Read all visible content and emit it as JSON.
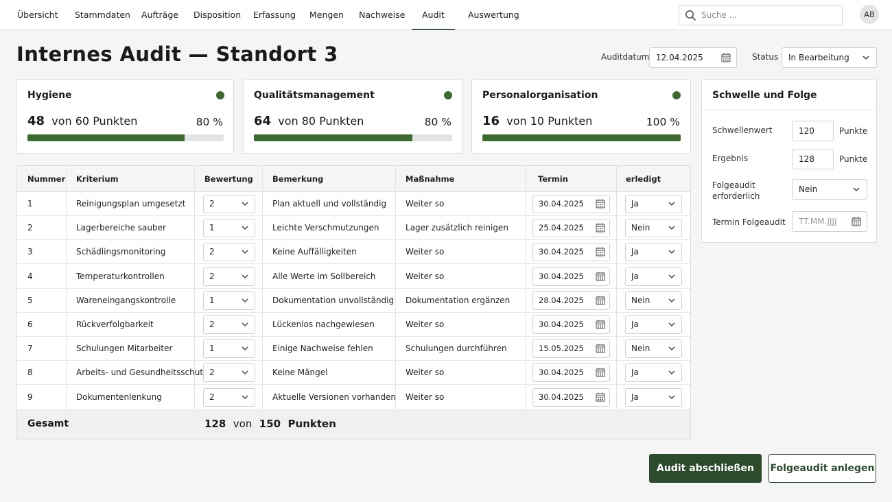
{
  "nav": {
    "tabs": [
      {
        "label": "Übersicht",
        "active": false
      },
      {
        "label": "Stammdaten",
        "active": false
      },
      {
        "label": "Aufträge",
        "active": false
      },
      {
        "label": "Disposition",
        "active": false
      },
      {
        "label": "Erfassung",
        "active": false
      },
      {
        "label": "Mengen",
        "active": false
      },
      {
        "label": "Nachweise",
        "active": false
      },
      {
        "label": "Audit",
        "active": true
      },
      {
        "label": "Auswertung",
        "active": false
      }
    ],
    "search_placeholder": "Suche ...",
    "search_icon": "search-icon",
    "avatar_initials": "AB"
  },
  "header": {
    "title": "Internes Audit — Standort 3",
    "auditdate_label": "Auditdatum",
    "auditdate_value": "12.04.2025",
    "status_label": "Status",
    "status_value": "In Bearbeitung"
  },
  "colors": {
    "accent": "#3b6a2e",
    "primary_button": "#2c4a2c",
    "progress_track": "#e3e3e3"
  },
  "cards": [
    {
      "title": "Hygiene",
      "score": "48",
      "of_label": "von",
      "max": "60",
      "unit": "Punkten",
      "percent": 80,
      "percent_label": "80 %"
    },
    {
      "title": "Qualitätsmanagement",
      "score": "64",
      "of_label": "von",
      "max": "80",
      "unit": "Punkten",
      "percent": 80,
      "percent_label": "80 %"
    },
    {
      "title": "Personalorganisation",
      "score": "16",
      "of_label": "von",
      "max": "10",
      "unit": "Punkten",
      "percent": 100,
      "percent_label": "100 %"
    }
  ],
  "panel": {
    "title": "Schwelle und Folge",
    "threshold_label": "Schwellenwert",
    "threshold_value": "120",
    "threshold_unit": "Punkte",
    "result_label": "Ergebnis",
    "result_value": "128",
    "result_unit": "Punkte",
    "followup_label": "Folgeaudit erforderlich",
    "followup_value": "Nein",
    "followup_date_label": "Termin Folgeaudit",
    "followup_date_placeholder": "TT.MM.JJJJ"
  },
  "table": {
    "headers": {
      "nummer": "Nummer",
      "kriterium": "Kriterium",
      "bewertung": "Bewertung",
      "bemerkung": "Bemerkung",
      "massnahme": "Maßnahme",
      "termin": "Termin",
      "erledigt": "erledigt"
    },
    "rows": [
      {
        "nummer": "1",
        "kriterium": "Reinigungsplan umgesetzt",
        "bewertung": "2",
        "bemerkung": "Plan aktuell und vollständig",
        "massnahme": "Weiter so",
        "termin": "30.04.2025",
        "erledigt": "Ja"
      },
      {
        "nummer": "2",
        "kriterium": "Lagerbereiche sauber",
        "bewertung": "1",
        "bemerkung": "Leichte Verschmutzungen",
        "massnahme": "Lager zusätzlich reinigen",
        "termin": "25.04.2025",
        "erledigt": "Nein"
      },
      {
        "nummer": "3",
        "kriterium": "Schädlingsmonitoring",
        "bewertung": "2",
        "bemerkung": "Keine Auffälligkeiten",
        "massnahme": "Weiter so",
        "termin": "30.04.2025",
        "erledigt": "Ja"
      },
      {
        "nummer": "4",
        "kriterium": "Temperaturkontrollen",
        "bewertung": "2",
        "bemerkung": "Alle Werte im Sollbereich",
        "massnahme": "Weiter so",
        "termin": "30.04.2025",
        "erledigt": "Ja"
      },
      {
        "nummer": "5",
        "kriterium": "Wareneingangskontrolle",
        "bewertung": "1",
        "bemerkung": "Dokumentation unvollständig",
        "massnahme": "Dokumentation ergänzen",
        "termin": "28.04.2025",
        "erledigt": "Nein"
      },
      {
        "nummer": "6",
        "kriterium": "Rückverfolgbarkeit",
        "bewertung": "2",
        "bemerkung": "Lückenlos nachgewiesen",
        "massnahme": "Weiter so",
        "termin": "30.04.2025",
        "erledigt": "Ja"
      },
      {
        "nummer": "7",
        "kriterium": "Schulungen Mitarbeiter",
        "bewertung": "1",
        "bemerkung": "Einige Nachweise fehlen",
        "massnahme": "Schulungen durchführen",
        "termin": "15.05.2025",
        "erledigt": "Nein"
      },
      {
        "nummer": "8",
        "kriterium": "Arbeits- und Gesundheitsschutz",
        "bewertung": "2",
        "bemerkung": "Keine Mängel",
        "massnahme": "Weiter so",
        "termin": "30.04.2025",
        "erledigt": "Ja"
      },
      {
        "nummer": "9",
        "kriterium": "Dokumentenlenkung",
        "bewertung": "2",
        "bemerkung": "Aktuelle Versionen vorhanden",
        "massnahme": "Weiter so",
        "termin": "30.04.2025",
        "erledigt": "Ja"
      }
    ],
    "footer": {
      "label": "Gesamt",
      "total": "128",
      "of_label": "von",
      "max": "150",
      "unit": "Punkten"
    }
  },
  "buttons": {
    "finish": "Audit abschließen",
    "followup": "Folgeaudit anlegen"
  }
}
